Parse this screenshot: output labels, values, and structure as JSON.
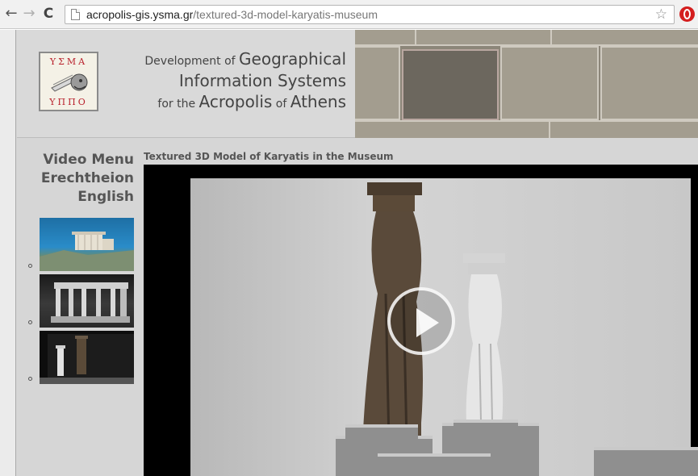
{
  "browser": {
    "url_host": "acropolis-gis.ysma.gr",
    "url_path": "/textured-3d-model-karyatis-museum",
    "back_glyph": "←",
    "forward_glyph": "→",
    "reload_glyph": "C",
    "star_glyph": "☆",
    "icons": [
      "back-arrow-icon",
      "forward-arrow-icon",
      "reload-icon",
      "page-icon",
      "star-icon",
      "opera-icon"
    ]
  },
  "header": {
    "logo": {
      "top_text": "ΥΣΜΑ",
      "bottom_text": "ΥΠΠΟ"
    },
    "title": {
      "line1_small1": "Development of ",
      "line1_big": "Geographical",
      "line2_big": "Information Systems",
      "line3_small1": "for the ",
      "line3_big1": "Acropolis",
      "line3_small2": " of ",
      "line3_big2": "Athens"
    }
  },
  "sidebar": {
    "title_lines": [
      "Video Menu",
      "Erechtheion",
      "English"
    ],
    "thumbnails": [
      {
        "subject": "erechtheion-aerial"
      },
      {
        "subject": "caryatid-porch"
      },
      {
        "subject": "karyatis-museum"
      }
    ]
  },
  "video": {
    "title": "Textured 3D Model of Karyatis in the Museum",
    "play_icon": "play-icon"
  },
  "colors": {
    "page_bg": "#d6d6d6",
    "heading_text": "#444444",
    "logo_red": "#b8202b",
    "video_bg": "#000000"
  }
}
